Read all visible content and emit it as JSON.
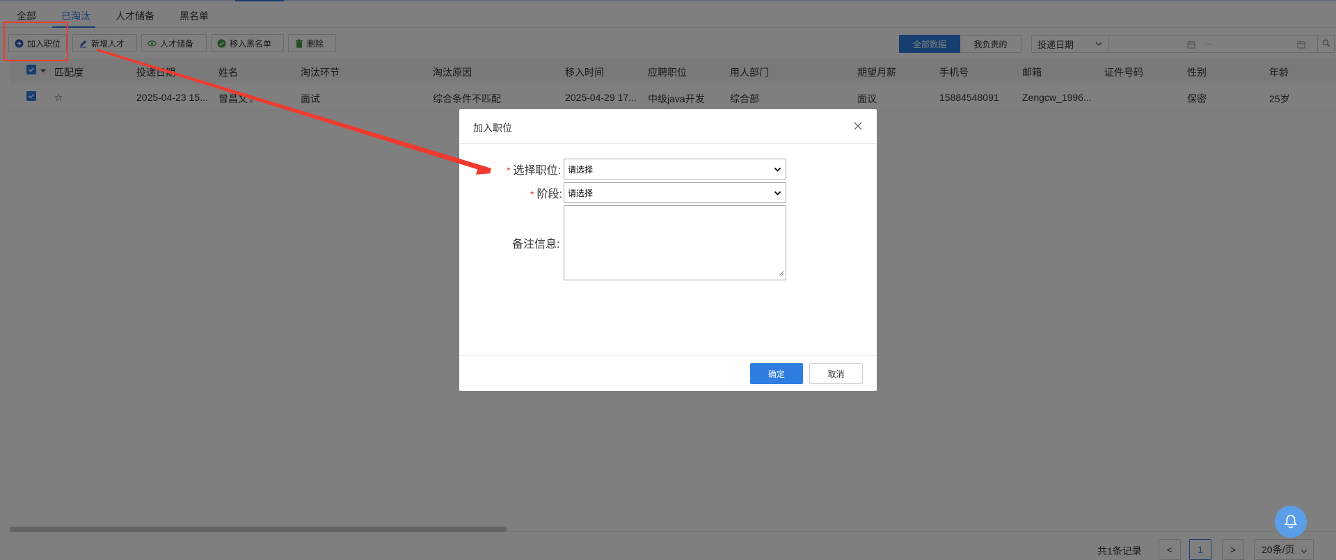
{
  "tabs": [
    {
      "label": "全部",
      "active": false
    },
    {
      "label": "已淘汰",
      "active": true
    },
    {
      "label": "人才储备",
      "active": false
    },
    {
      "label": "黑名单",
      "active": false
    }
  ],
  "toolbar": {
    "add_position": "加入职位",
    "new_talent": "新增人才",
    "talent_pool": "人才储备",
    "move_blacklist": "移入黑名单",
    "delete": "删除"
  },
  "scope": {
    "all": "全部数据",
    "mine": "我负责的"
  },
  "date_filter": {
    "selected": "投递日期"
  },
  "table": {
    "columns": [
      "匹配度",
      "投递日期",
      "姓名",
      "淘汰环节",
      "淘汰原因",
      "移入时间",
      "应聘职位",
      "用人部门",
      "期望月薪",
      "手机号",
      "邮箱",
      "证件号码",
      "性别",
      "年龄"
    ],
    "rows": [
      {
        "match": "☆",
        "apply_date": "2025-04-23 15...",
        "name": "曾昌文",
        "name_badge": "2",
        "stage": "面试",
        "reason": "综合条件不匹配",
        "moved_time": "2025-04-29 17...",
        "position": "中级java开发",
        "department": "综合部",
        "salary": "面议",
        "phone": "15884548091",
        "email": "Zengcw_1996...",
        "id_no": "",
        "gender": "保密",
        "age": "25岁"
      }
    ]
  },
  "pager": {
    "total": "共1条记录",
    "prev": "<",
    "page": "1",
    "next": ">",
    "size": "20条/页"
  },
  "dialog": {
    "title": "加入职位",
    "position_label": "选择职位:",
    "position_value": "请选择",
    "stage_label": "阶段:",
    "stage_value": "请选择",
    "note_label": "备注信息:",
    "ok": "确定",
    "cancel": "取消"
  },
  "colors": {
    "primary": "#2f7de1",
    "annotation": "#f03a2e",
    "mask": "rgba(0,0,0,0.5)"
  }
}
